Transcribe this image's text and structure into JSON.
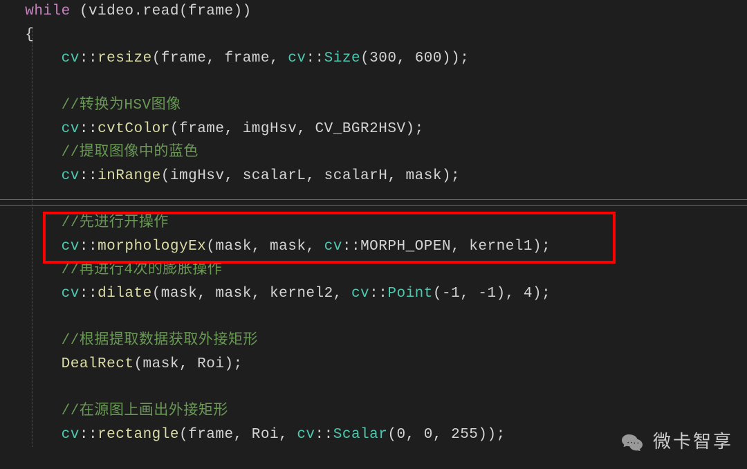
{
  "code": {
    "line1_while": "while",
    "line1_rest": " (video.read(frame))",
    "line2": "{",
    "line3_ns": "cv",
    "line3_scope": "::",
    "line3_method": "resize",
    "line3_args": "(frame, frame, ",
    "line3_ns2": "cv",
    "line3_scope2": "::",
    "line3_type": "Size",
    "line3_nums": "(300, 600));",
    "line5_comment": "//转换为HSV图像",
    "line6_ns": "cv",
    "line6_scope": "::",
    "line6_method": "cvtColor",
    "line6_args": "(frame, imgHsv, CV_BGR2HSV);",
    "line7_comment": "//提取图像中的蓝色",
    "line8_ns": "cv",
    "line8_scope": "::",
    "line8_method": "inRange",
    "line8_args": "(imgHsv, scalarL, scalarH, mask);",
    "line10_comment": "//先进行开操作",
    "line11_ns": "cv",
    "line11_scope": "::",
    "line11_method": "morphologyEx",
    "line11_args1": "(mask, mask, ",
    "line11_ns2": "cv",
    "line11_scope2": "::",
    "line11_const": "MORPH_OPEN",
    "line11_args2": ", kernel1);",
    "line12_comment": "//再进行4次的膨胀操作",
    "line13_ns": "cv",
    "line13_scope": "::",
    "line13_method": "dilate",
    "line13_args1": "(mask, mask, kernel2, ",
    "line13_ns2": "cv",
    "line13_scope2": "::",
    "line13_type": "Point",
    "line13_args2": "(-1, -1), 4);",
    "line15_comment": "//根据提取数据获取外接矩形",
    "line16_method": "DealRect",
    "line16_args": "(mask, Roi);",
    "line18_comment": "//在源图上画出外接矩形",
    "line19_ns": "cv",
    "line19_scope": "::",
    "line19_method": "rectangle",
    "line19_args1": "(frame, Roi, ",
    "line19_ns2": "cv",
    "line19_scope2": "::",
    "line19_type": "Scalar",
    "line19_args2": "(0, 0, 255));"
  },
  "watermark": {
    "text": "微卡智享"
  }
}
